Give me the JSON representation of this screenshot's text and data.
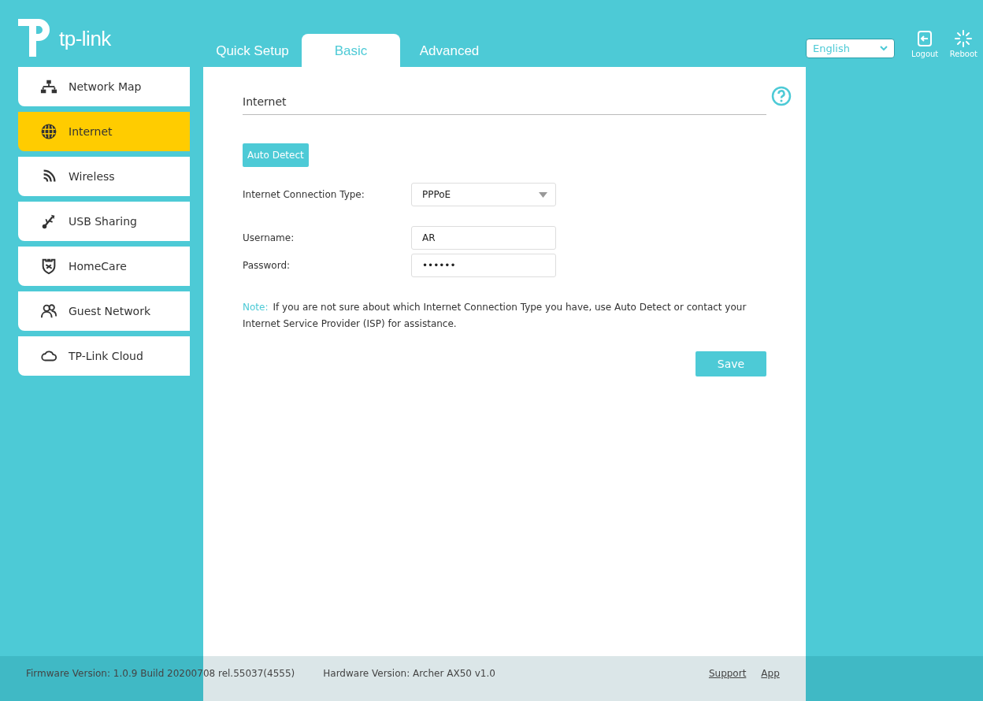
{
  "header": {
    "logo": "tp-link",
    "tabs": [
      {
        "label": "Quick Setup",
        "selected": false
      },
      {
        "label": "Basic",
        "selected": true
      },
      {
        "label": "Advanced",
        "selected": false
      }
    ],
    "language": "English",
    "actions": [
      {
        "kind": "logout",
        "label": "Logout"
      },
      {
        "kind": "reboot",
        "label": "Reboot"
      }
    ]
  },
  "sidebar": {
    "items": [
      {
        "kind": "network-map",
        "label": "Network Map",
        "selected": false
      },
      {
        "kind": "internet",
        "label": "Internet",
        "selected": true
      },
      {
        "kind": "wireless",
        "label": "Wireless",
        "selected": false
      },
      {
        "kind": "usb",
        "label": "USB Sharing",
        "selected": false
      },
      {
        "kind": "homecare",
        "label": "HomeCare",
        "selected": false
      },
      {
        "kind": "guest",
        "label": "Guest Network",
        "selected": false
      },
      {
        "kind": "cloud",
        "label": "TP-Link Cloud",
        "selected": false
      }
    ]
  },
  "content": {
    "title": "Internet",
    "auto_detect": "Auto Detect",
    "connection_type": {
      "label": "Internet Connection Type:",
      "value": "PPPoE"
    },
    "username": {
      "label": "Username:",
      "value": "AR"
    },
    "password": {
      "label": "Password:",
      "value": "••••••"
    },
    "note_label": "Note:",
    "note": "If you are not sure about which Internet Connection Type you have, use Auto Detect or contact your Internet Service Provider (ISP) for assistance.",
    "save": "Save"
  },
  "footer": {
    "firmware": "Firmware Version: 1.0.9 Build 20200708 rel.55037(4555)",
    "hardware": "Hardware Version: Archer AX50 v1.0",
    "links": [
      "Support",
      "App"
    ]
  }
}
